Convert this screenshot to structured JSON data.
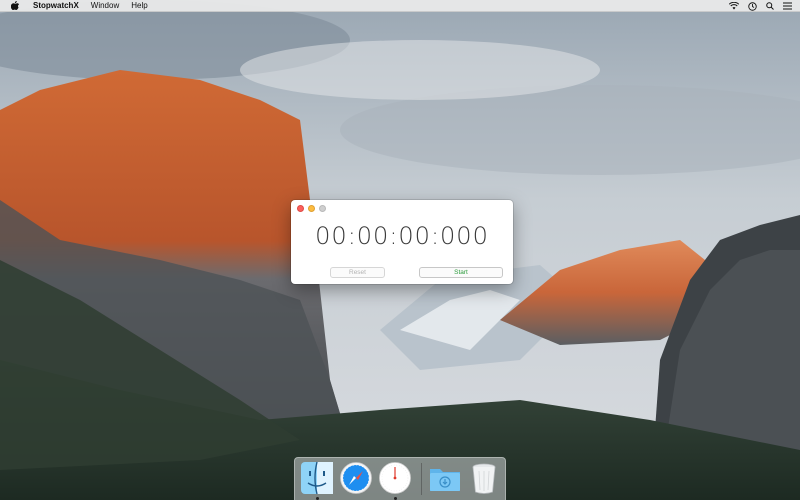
{
  "menubar": {
    "apple_icon": "apple-icon",
    "app_name": "StopwatchX",
    "menus": [
      "Window",
      "Help"
    ],
    "status_icons": [
      "wifi-icon",
      "clock-icon",
      "search-icon",
      "list-icon"
    ]
  },
  "stopwatch": {
    "time": "00:00:00:000",
    "reset_label": "Reset",
    "start_label": "Start",
    "colors": {
      "start_text": "#2d9c3d",
      "reset_text": "#b3b3b3"
    }
  },
  "dock": {
    "apps": [
      {
        "name": "Finder",
        "icon": "finder-icon",
        "running": true
      },
      {
        "name": "Safari",
        "icon": "safari-icon",
        "running": false
      },
      {
        "name": "StopwatchX",
        "icon": "stopwatch-icon",
        "running": true
      }
    ],
    "others": [
      {
        "name": "Downloads",
        "icon": "downloads-folder-icon"
      },
      {
        "name": "Trash",
        "icon": "trash-icon"
      }
    ]
  }
}
